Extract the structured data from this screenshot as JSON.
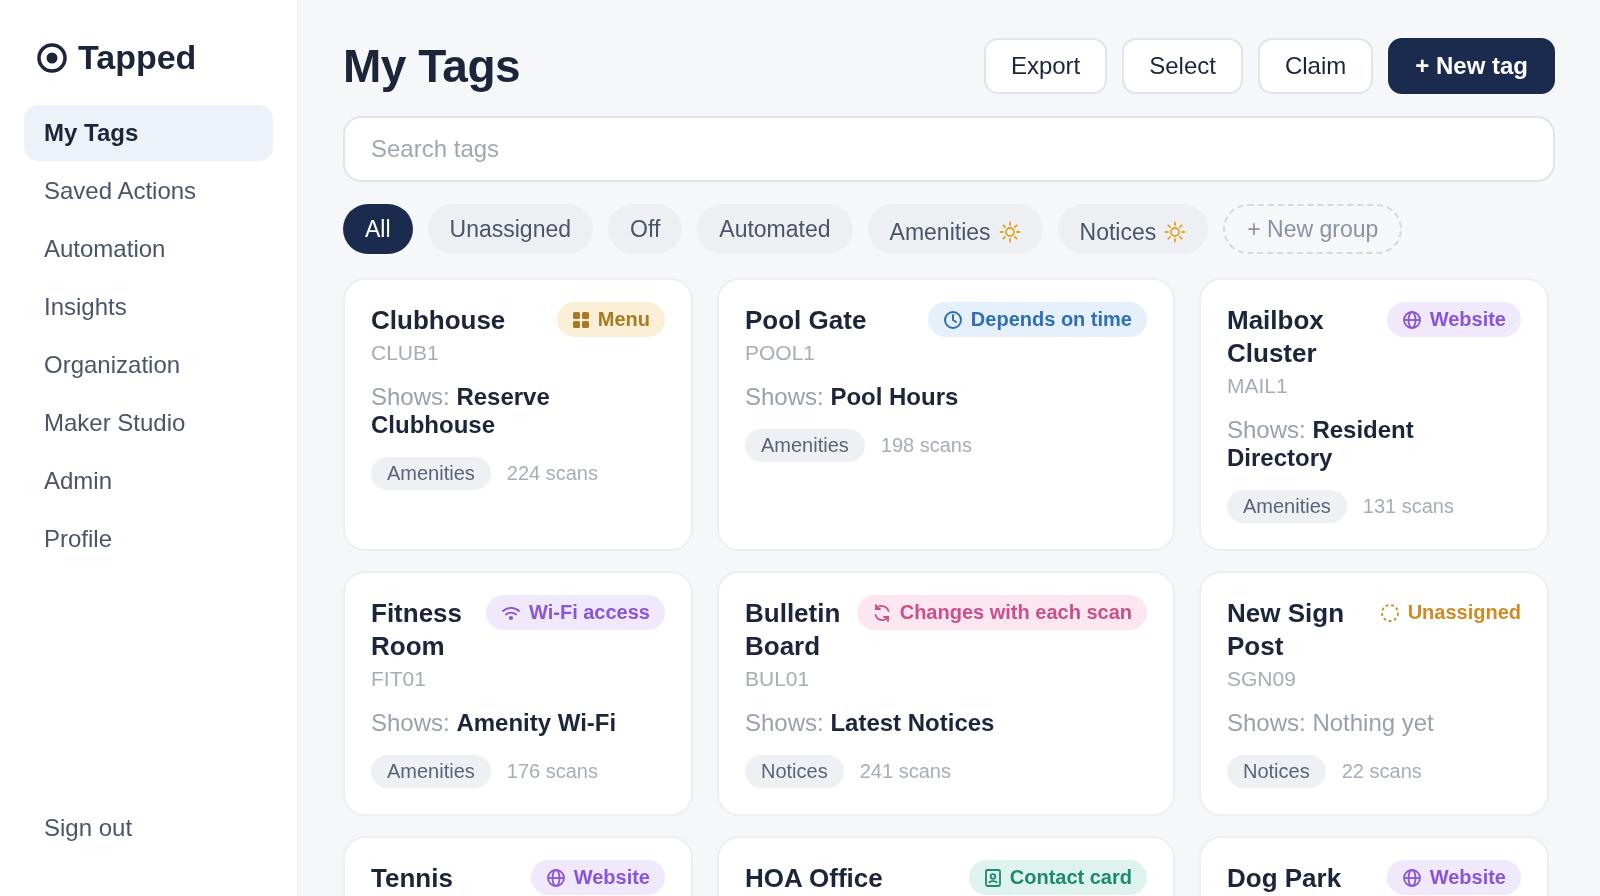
{
  "brand": {
    "name": "Tapped"
  },
  "sidebar": {
    "items": [
      {
        "label": "My Tags",
        "selected": true
      },
      {
        "label": "Saved Actions",
        "selected": false
      },
      {
        "label": "Automation",
        "selected": false
      },
      {
        "label": "Insights",
        "selected": false
      },
      {
        "label": "Organization",
        "selected": false
      },
      {
        "label": "Maker Studio",
        "selected": false
      },
      {
        "label": "Admin",
        "selected": false
      },
      {
        "label": "Profile",
        "selected": false
      }
    ],
    "footer": "Sign out"
  },
  "header": {
    "title": "My Tags",
    "buttons": [
      {
        "label": "Export",
        "kind": "outline"
      },
      {
        "label": "Select",
        "kind": "outline"
      },
      {
        "label": "Claim",
        "kind": "outline"
      },
      {
        "label": "+ New tag",
        "kind": "primary"
      }
    ]
  },
  "search": {
    "placeholder": "Search tags"
  },
  "filters": [
    {
      "label": "All",
      "selected": true,
      "kind": "plain"
    },
    {
      "label": "Unassigned",
      "selected": false,
      "kind": "plain"
    },
    {
      "label": "Off",
      "selected": false,
      "kind": "plain"
    },
    {
      "label": "Automated",
      "selected": false,
      "kind": "plain"
    },
    {
      "label": "Amenities",
      "selected": false,
      "kind": "group"
    },
    {
      "label": "Notices",
      "selected": false,
      "kind": "group"
    }
  ],
  "new_group": "+ New group",
  "cards": [
    {
      "name": "Clubhouse",
      "badge": {
        "kind": "menu",
        "label": "Menu"
      },
      "code": "CLUB1",
      "shows_label": "Shows:",
      "shows": "Reserve Clubhouse",
      "assigned": true,
      "group": "Amenities",
      "scans": "224 scans"
    },
    {
      "name": "Pool Gate",
      "badge": {
        "kind": "time",
        "label": "Depends on time"
      },
      "code": "POOL1",
      "shows_label": "Shows:",
      "shows": "Pool Hours",
      "assigned": true,
      "group": "Amenities",
      "scans": "198 scans"
    },
    {
      "name": "Mailbox Cluster",
      "badge": {
        "kind": "website",
        "label": "Website"
      },
      "code": "MAIL1",
      "shows_label": "Shows:",
      "shows": "Resident Directory",
      "assigned": true,
      "group": "Amenities",
      "scans": "131 scans"
    },
    {
      "name": "Fitness Room",
      "badge": {
        "kind": "wifi",
        "label": "Wi-Fi access"
      },
      "code": "FIT01",
      "shows_label": "Shows:",
      "shows": "Amenity Wi-Fi",
      "assigned": true,
      "group": "Amenities",
      "scans": "176 scans"
    },
    {
      "name": "Bulletin Board",
      "badge": {
        "kind": "rotate",
        "label": "Changes with each scan"
      },
      "code": "BUL01",
      "shows_label": "Shows:",
      "shows": "Latest Notices",
      "assigned": true,
      "group": "Notices",
      "scans": "241 scans"
    },
    {
      "name": "New Sign Post",
      "badge": {
        "kind": "unassigned",
        "label": "Unassigned"
      },
      "code": "SGN09",
      "shows_label": "Shows:",
      "shows": "Nothing yet",
      "assigned": false,
      "group": "Notices",
      "scans": "22 scans"
    },
    {
      "name": "Tennis",
      "badge": {
        "kind": "website",
        "label": "Website"
      }
    },
    {
      "name": "HOA Office",
      "badge": {
        "kind": "contact",
        "label": "Contact card"
      }
    },
    {
      "name": "Dog Park",
      "badge": {
        "kind": "website",
        "label": "Website"
      }
    }
  ]
}
